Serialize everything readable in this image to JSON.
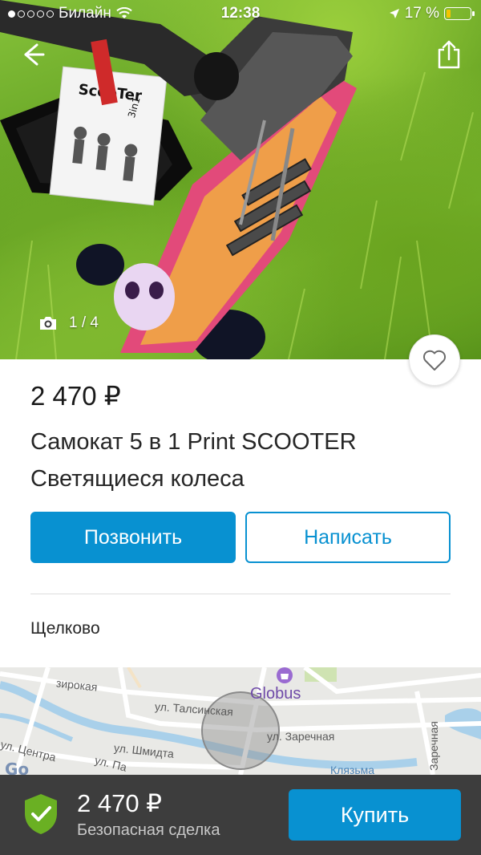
{
  "status_bar": {
    "carrier": "Билайн",
    "time": "12:38",
    "battery_percent": "17 %",
    "battery_level": 0.17,
    "signal_bars_filled": 1
  },
  "photo": {
    "counter": "1 / 4",
    "scooter_card_text": "ScooTer",
    "scooter_card_badge": "3in1"
  },
  "listing": {
    "price": "2 470 ₽",
    "title_line1": "Самокат 5 в 1 Print SCOOTER",
    "title_line2": "Светящиеся колеса",
    "location": "Щелково"
  },
  "actions": {
    "call_label": "Позвонить",
    "write_label": "Написать"
  },
  "map": {
    "labels": {
      "street_1": "зирокая",
      "poi": "Globus",
      "street_talsinskaya": "ул. Талсинская",
      "street_zarechnaya": "ул. Заречная",
      "street_shmidta": "ул. Шмидта",
      "street_tsentralnaya": "ул. Центра",
      "street_pa": "ул. Па",
      "river": "Клязьма",
      "street_zarechnaya_vertical": "Заречная"
    }
  },
  "bottom_bar": {
    "price": "2 470 ₽",
    "caption": "Безопасная сделка",
    "buy_label": "Купить"
  },
  "icons": {
    "back": "arrow-left-icon",
    "share": "share-icon",
    "camera": "camera-icon",
    "favorite": "heart-icon",
    "location_arrow": "location-arrow-icon",
    "wifi": "wifi-icon",
    "shield": "shield-check-icon",
    "poi": "shopping-bag-icon"
  },
  "colors": {
    "accent": "#0891d1",
    "bottom_bar": "#3d3d3d",
    "shield_green": "#6ab023",
    "battery": "#f5c400"
  }
}
